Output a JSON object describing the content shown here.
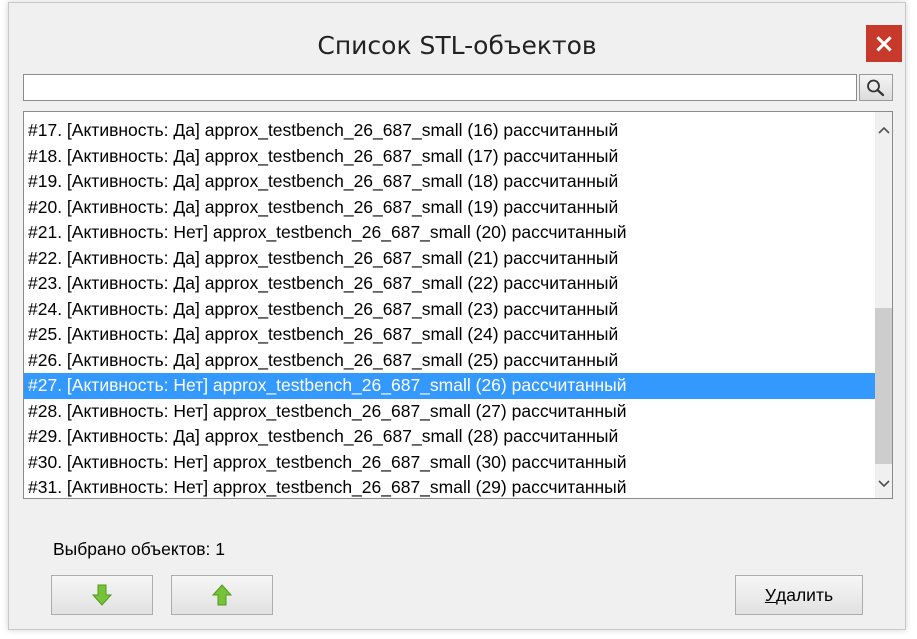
{
  "window": {
    "title": "Список STL-объектов",
    "close_glyph": "×"
  },
  "search": {
    "value": "",
    "placeholder": "",
    "button_icon": "search-icon"
  },
  "list": {
    "selected_index": 10,
    "items": [
      "#17. [Активность: Да] approx_testbench_26_687_small (16) рассчитанный",
      "#18. [Активность: Да] approx_testbench_26_687_small (17) рассчитанный",
      "#19. [Активность: Да] approx_testbench_26_687_small (18) рассчитанный",
      "#20. [Активность: Да] approx_testbench_26_687_small (19) рассчитанный",
      "#21. [Активность: Нет] approx_testbench_26_687_small (20) рассчитанный",
      "#22. [Активность: Да] approx_testbench_26_687_small (21) рассчитанный",
      "#23. [Активность: Да] approx_testbench_26_687_small (22) рассчитанный",
      "#24. [Активность: Да] approx_testbench_26_687_small (23) рассчитанный",
      "#25. [Активность: Да] approx_testbench_26_687_small (24) рассчитанный",
      "#26. [Активность: Да] approx_testbench_26_687_small (25) рассчитанный",
      "#27. [Активность: Нет] approx_testbench_26_687_small (26) рассчитанный",
      "#28. [Активность: Нет] approx_testbench_26_687_small (27) рассчитанный",
      "#29. [Активность: Да] approx_testbench_26_687_small (28) рассчитанный",
      "#30. [Активность: Нет] approx_testbench_26_687_small (30) рассчитанный",
      "#31. [Активность: Нет] approx_testbench_26_687_small (29) рассчитанный"
    ]
  },
  "status": {
    "selected_count_text": "Выбрано объектов: 1"
  },
  "buttons": {
    "move_down_icon": "arrow-down-icon",
    "move_up_icon": "arrow-up-icon",
    "delete_label_first": "У",
    "delete_label_rest": "далить"
  },
  "colors": {
    "selection": "#3399ff",
    "close_button": "#c7392b",
    "arrow_green": "#78c23a"
  }
}
